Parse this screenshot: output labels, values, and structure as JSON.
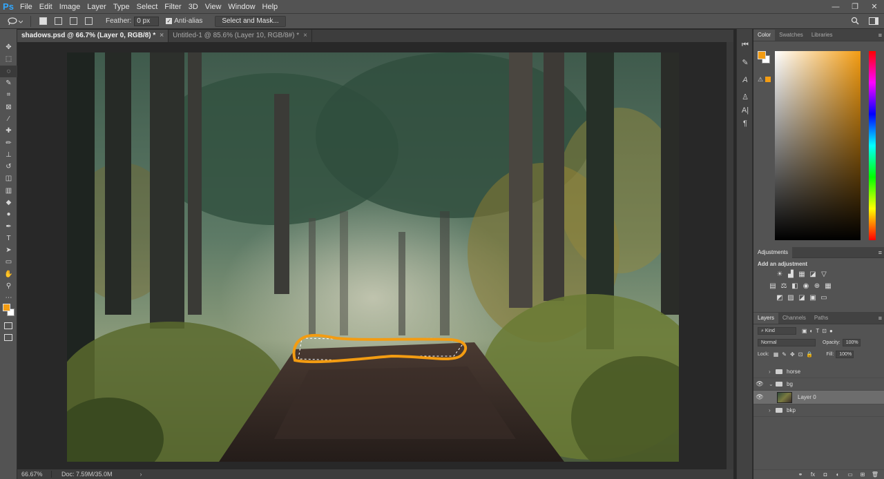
{
  "app": {
    "logo": "Ps"
  },
  "menu": [
    "File",
    "Edit",
    "Image",
    "Layer",
    "Type",
    "Select",
    "Filter",
    "3D",
    "View",
    "Window",
    "Help"
  ],
  "window_controls": [
    "—",
    "❐",
    "✕"
  ],
  "options": {
    "feather_label": "Feather:",
    "feather_value": "0 px",
    "antialias_label": "Anti-alias",
    "select_mask_label": "Select and Mask..."
  },
  "tabs": [
    {
      "label": "shadows.psd @ 66.7% (Layer 0, RGB/8) *",
      "active": true
    },
    {
      "label": "Untitled-1 @ 85.6% (Layer 10, RGB/8#) *",
      "active": false
    }
  ],
  "status": {
    "zoom": "66.67%",
    "doc": "Doc: 7.59M/35.0M"
  },
  "colors": {
    "foreground": "#f39c12",
    "background": "#ffffff",
    "accent": "#f39c12"
  },
  "tools": [
    "move-icon",
    "marquee-icon",
    "lasso-icon",
    "quick-select-icon",
    "crop-icon",
    "frame-icon",
    "eyedropper-icon",
    "healing-icon",
    "brush-icon",
    "stamp-icon",
    "history-brush-icon",
    "eraser-icon",
    "gradient-icon",
    "blur-icon",
    "dodge-icon",
    "pen-icon",
    "type-icon",
    "path-select-icon",
    "rectangle-icon",
    "hand-icon",
    "zoom-icon",
    "more-icon"
  ],
  "panels": {
    "color_tabs": [
      "Color",
      "Swatches",
      "Libraries"
    ],
    "adjustments_title": "Adjustments",
    "adjustments_subtitle": "Add an adjustment",
    "layers_tabs": [
      "Layers",
      "Channels",
      "Paths"
    ],
    "kind_label": "Kind",
    "blend_mode": "Normal",
    "opacity_label": "Opacity:",
    "opacity_value": "100%",
    "lock_label": "Lock:",
    "fill_label": "Fill:",
    "fill_value": "100%",
    "layers": [
      {
        "name": "horse",
        "type": "group",
        "visible": false,
        "open": false
      },
      {
        "name": "bg",
        "type": "group",
        "visible": true,
        "open": true
      },
      {
        "name": "Layer 0",
        "type": "layer",
        "visible": true,
        "selected": true
      },
      {
        "name": "bkp",
        "type": "group",
        "visible": false,
        "open": false
      }
    ],
    "layer_footer": [
      "⚭",
      "fx",
      "◘",
      "◐",
      "▭",
      "⊞",
      "🗑"
    ]
  }
}
